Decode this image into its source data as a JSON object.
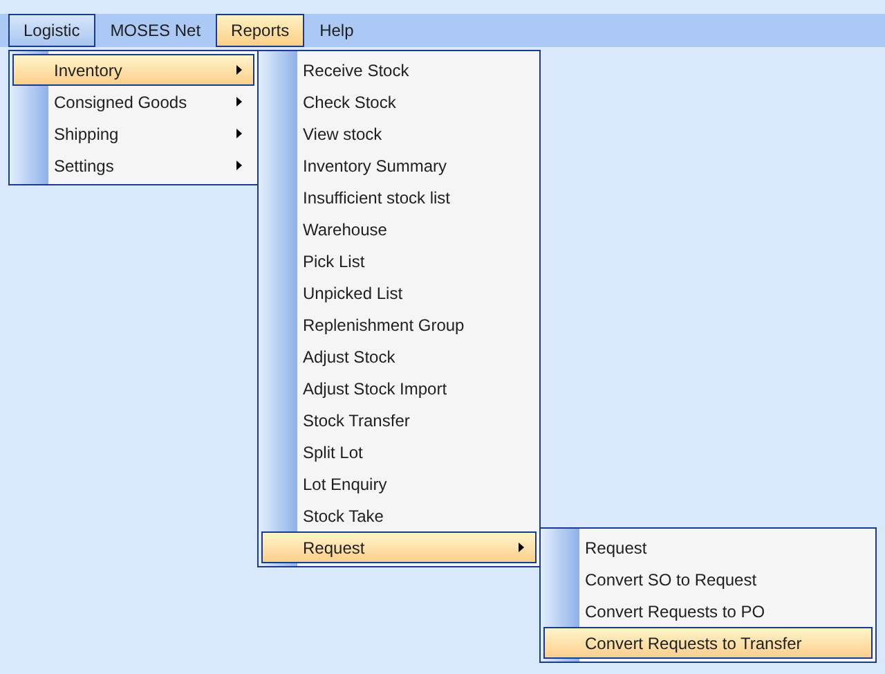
{
  "menubar": [
    {
      "label": "Logistic",
      "open": true,
      "selected": false,
      "children": [
        {
          "label": "Inventory",
          "has_submenu": true,
          "selected": true,
          "children": [
            {
              "label": "Receive Stock",
              "has_submenu": false,
              "selected": false
            },
            {
              "label": "Check Stock",
              "has_submenu": false,
              "selected": false
            },
            {
              "label": "View stock",
              "has_submenu": false,
              "selected": false
            },
            {
              "label": "Inventory Summary",
              "has_submenu": false,
              "selected": false
            },
            {
              "label": "Insufficient stock list",
              "has_submenu": false,
              "selected": false
            },
            {
              "label": "Warehouse",
              "has_submenu": false,
              "selected": false
            },
            {
              "label": "Pick List",
              "has_submenu": false,
              "selected": false
            },
            {
              "label": "Unpicked List",
              "has_submenu": false,
              "selected": false
            },
            {
              "label": "Replenishment Group",
              "has_submenu": false,
              "selected": false
            },
            {
              "label": "Adjust Stock",
              "has_submenu": false,
              "selected": false
            },
            {
              "label": "Adjust Stock Import",
              "has_submenu": false,
              "selected": false
            },
            {
              "label": "Stock Transfer",
              "has_submenu": false,
              "selected": false
            },
            {
              "label": "Split Lot",
              "has_submenu": false,
              "selected": false
            },
            {
              "label": "Lot Enquiry",
              "has_submenu": false,
              "selected": false
            },
            {
              "label": "Stock Take",
              "has_submenu": false,
              "selected": false
            },
            {
              "label": "Request",
              "has_submenu": true,
              "selected": true,
              "children": [
                {
                  "label": "Request",
                  "has_submenu": false,
                  "selected": false
                },
                {
                  "label": "Convert SO to Request",
                  "has_submenu": false,
                  "selected": false
                },
                {
                  "label": "Convert Requests to PO",
                  "has_submenu": false,
                  "selected": false
                },
                {
                  "label": "Convert Requests to Transfer",
                  "has_submenu": false,
                  "selected": true
                }
              ]
            }
          ]
        },
        {
          "label": "Consigned Goods",
          "has_submenu": true,
          "selected": false
        },
        {
          "label": "Shipping",
          "has_submenu": true,
          "selected": false
        },
        {
          "label": "Settings",
          "has_submenu": true,
          "selected": false
        }
      ]
    },
    {
      "label": "MOSES Net",
      "open": false,
      "selected": false
    },
    {
      "label": "Reports",
      "open": false,
      "selected": true
    },
    {
      "label": "Help",
      "open": false,
      "selected": false
    }
  ]
}
